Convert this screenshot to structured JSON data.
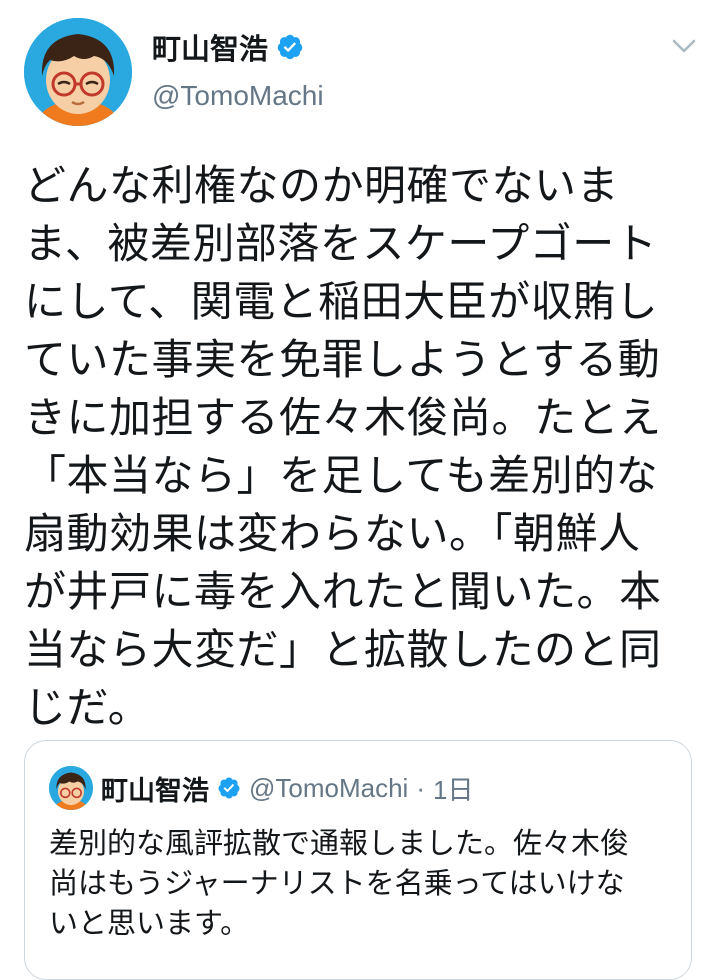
{
  "tweet": {
    "author": {
      "display_name": "町山智浩",
      "handle": "@TomoMachi",
      "verified": true,
      "avatar_icon": "cartoon-avatar-icon"
    },
    "text_lines": [
      "どんな利権なのか明確でないま",
      "ま、被差別部落をスケープゴート",
      "にして、関電と稲田大臣が収賄し",
      "ていた事実を免罪しようとする動",
      "きに加担する佐々木俊尚。たとえ",
      "「本当なら」を足しても差別的な",
      "扇動効果は変わらない。「朝鮮人",
      "が井戸に毒を入れたと聞いた。本",
      "当なら大変だ」と拡散したのと同",
      "じだ。"
    ],
    "menu_icon": "chevron-down-icon"
  },
  "quoted_tweet": {
    "display_name": "町山智浩",
    "handle": "@TomoMachi",
    "separator": "·",
    "time": "1日",
    "text_lines": [
      "差別的な風評拡散で通報しました。佐々木俊",
      "尚はもうジャーナリストを名乗ってはいけな",
      "いと思います。"
    ]
  },
  "colors": {
    "verified_blue": "#1da1f2",
    "secondary_text": "#657786",
    "border": "#ccd6dd",
    "avatar_bg": "#2aa9e0"
  }
}
